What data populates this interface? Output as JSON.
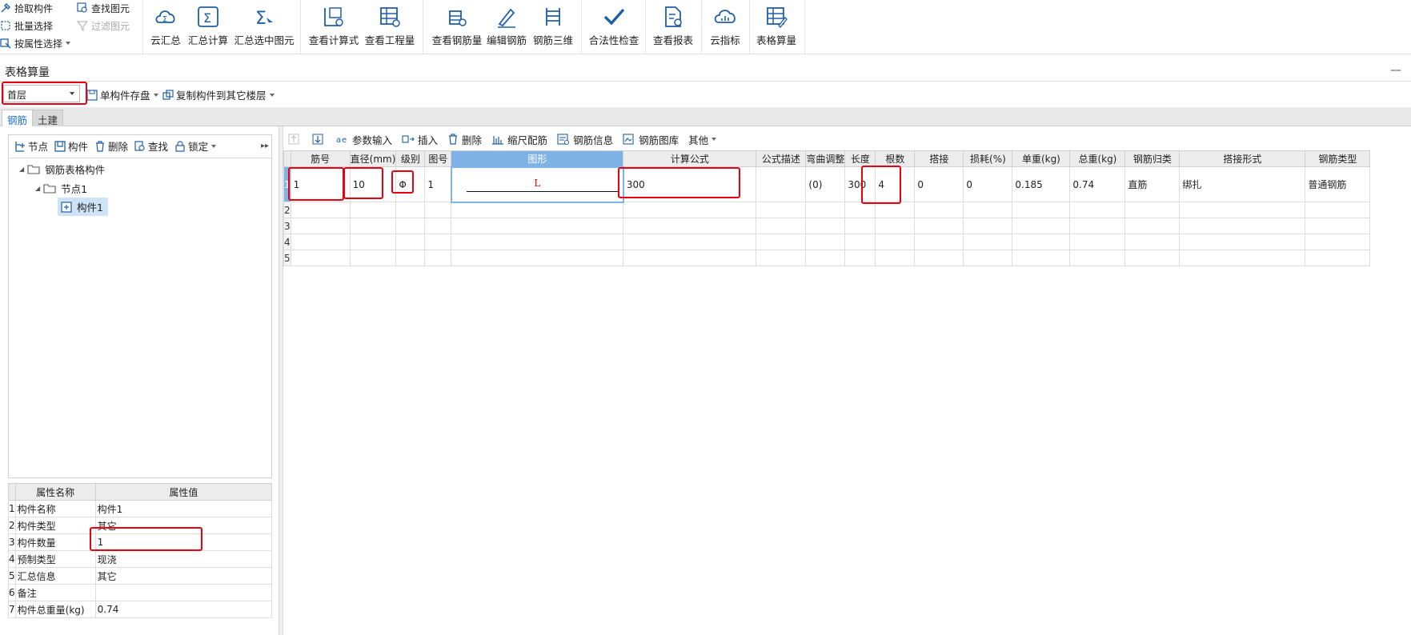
{
  "ribbon": {
    "small_items": [
      {
        "label": "拾取构件",
        "icon": "pick-icon"
      },
      {
        "label": "批量选择",
        "icon": "batch-select-icon"
      },
      {
        "label": "按属性选择",
        "icon": "select-by-attr-icon"
      },
      {
        "label": "查找图元",
        "icon": "find-element-icon"
      },
      {
        "label": "过滤图元",
        "icon": "filter-element-icon",
        "disabled": true
      }
    ],
    "buttons": [
      {
        "label": "云汇总",
        "icon": "cloud-sum-icon"
      },
      {
        "label": "汇总计算",
        "icon": "sum-calc-icon"
      },
      {
        "label": "汇总选中图元",
        "icon": "sum-selected-icon"
      },
      {
        "label": "查看计算式",
        "icon": "view-formula-icon"
      },
      {
        "label": "查看工程量",
        "icon": "view-quantity-icon"
      },
      {
        "label": "查看钢筋量",
        "icon": "view-rebar-icon"
      },
      {
        "label": "编辑钢筋",
        "icon": "edit-rebar-icon"
      },
      {
        "label": "钢筋三维",
        "icon": "rebar-3d-icon"
      },
      {
        "label": "合法性检查",
        "icon": "check-icon"
      },
      {
        "label": "查看报表",
        "icon": "view-report-icon"
      },
      {
        "label": "云指标",
        "icon": "cloud-index-icon"
      },
      {
        "label": "表格算量",
        "icon": "table-calc-icon"
      }
    ]
  },
  "panel": {
    "title": "表格算量",
    "minimize": "—"
  },
  "toolbar": {
    "floor": "首层",
    "save_single": "单构件存盘",
    "copy_to_floor": "复制构件到其它楼层"
  },
  "tabs": [
    {
      "label": "钢筋",
      "active": true
    },
    {
      "label": "土建",
      "active": false
    }
  ],
  "tree_toolbar": {
    "node": "节点",
    "component": "构件",
    "delete": "删除",
    "find": "查找",
    "lock": "锁定",
    "more": "▸▸"
  },
  "tree": {
    "root": "钢筋表格构件",
    "node": "节点1",
    "leaf": "构件1"
  },
  "properties": {
    "headers": [
      "属性名称",
      "属性值"
    ],
    "rows": [
      {
        "no": "1",
        "name": "构件名称",
        "value": "构件1"
      },
      {
        "no": "2",
        "name": "构件类型",
        "value": "其它"
      },
      {
        "no": "3",
        "name": "构件数量",
        "value": "1"
      },
      {
        "no": "4",
        "name": "预制类型",
        "value": "现浇"
      },
      {
        "no": "5",
        "name": "汇总信息",
        "value": "其它"
      },
      {
        "no": "6",
        "name": "备注",
        "value": ""
      },
      {
        "no": "7",
        "name": "构件总重量(kg)",
        "value": "0.74"
      }
    ]
  },
  "grid_toolbar": {
    "param_input": "参数输入",
    "insert": "插入",
    "delete": "删除",
    "ruler": "缩尺配筋",
    "rebar_info": "钢筋信息",
    "rebar_lib": "钢筋图库",
    "other": "其他"
  },
  "grid": {
    "headers": [
      "筋号",
      "直径(mm)",
      "级别",
      "图号",
      "图形",
      "计算公式",
      "公式描述",
      "弯曲调整",
      "长度",
      "根数",
      "搭接",
      "损耗(%)",
      "单重(kg)",
      "总重(kg)",
      "钢筋归类",
      "搭接形式",
      "钢筋类型"
    ],
    "rows": [
      {
        "no": "1",
        "cells": [
          "1",
          "10",
          "Φ",
          "1",
          "",
          "300",
          "",
          "(0)",
          "300",
          "4",
          "0",
          "0",
          "0.185",
          "0.74",
          "直筋",
          "绑扎",
          "普通钢筋"
        ]
      },
      {
        "no": "2",
        "cells": [
          "",
          "",
          "",
          "",
          "",
          "",
          "",
          "",
          "",
          "",
          "",
          "",
          "",
          "",
          "",
          "",
          ""
        ]
      },
      {
        "no": "3",
        "cells": [
          "",
          "",
          "",
          "",
          "",
          "",
          "",
          "",
          "",
          "",
          "",
          "",
          "",
          "",
          "",
          "",
          ""
        ]
      },
      {
        "no": "4",
        "cells": [
          "",
          "",
          "",
          "",
          "",
          "",
          "",
          "",
          "",
          "",
          "",
          "",
          "",
          "",
          "",
          "",
          ""
        ]
      },
      {
        "no": "5",
        "cells": [
          "",
          "",
          "",
          "",
          "",
          "",
          "",
          "",
          "",
          "",
          "",
          "",
          "",
          "",
          "",
          "",
          ""
        ]
      }
    ],
    "shape_label": "L"
  },
  "colors": {
    "highlight": "#e60012",
    "selected_header": "#7fb2e5",
    "tab_active": "#1a6fd0",
    "icon": "#1f5fa8"
  }
}
